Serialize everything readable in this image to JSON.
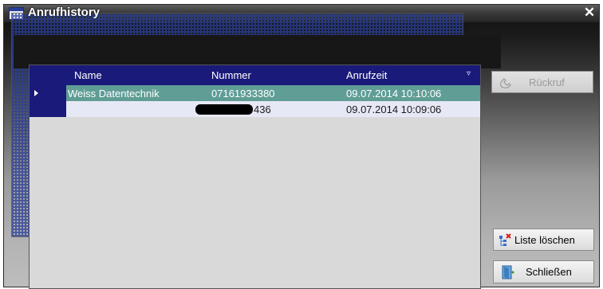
{
  "window": {
    "title": "Anrufhistory",
    "close_glyph": "✕"
  },
  "grid": {
    "columns": [
      "Name",
      "Nummer",
      "Anrufzeit"
    ],
    "sort_glyph": "▿",
    "rows": [
      {
        "name": "Weiss Datentechnik",
        "nummer": "07161933380",
        "anrufzeit": "09.07.2014 10:10:06",
        "selected": true
      },
      {
        "name": "",
        "nummer_visible_suffix": "436",
        "nummer_redacted": true,
        "anrufzeit": "09.07.2014 10:09:06",
        "selected": false
      }
    ]
  },
  "buttons": {
    "rueckruf": {
      "label": "Rückruf",
      "enabled": false,
      "icon": "phone-icon"
    },
    "liste_loeschen": {
      "label": "Liste löschen",
      "enabled": true,
      "icon": "delete-list-icon"
    },
    "schliessen": {
      "label": "Schließen",
      "enabled": true,
      "icon": "exit-door-icon"
    }
  },
  "colors": {
    "header_bg": "#1a1a7a",
    "selected_row": "#5f9d95",
    "alt_row": "#e7e8f6"
  }
}
